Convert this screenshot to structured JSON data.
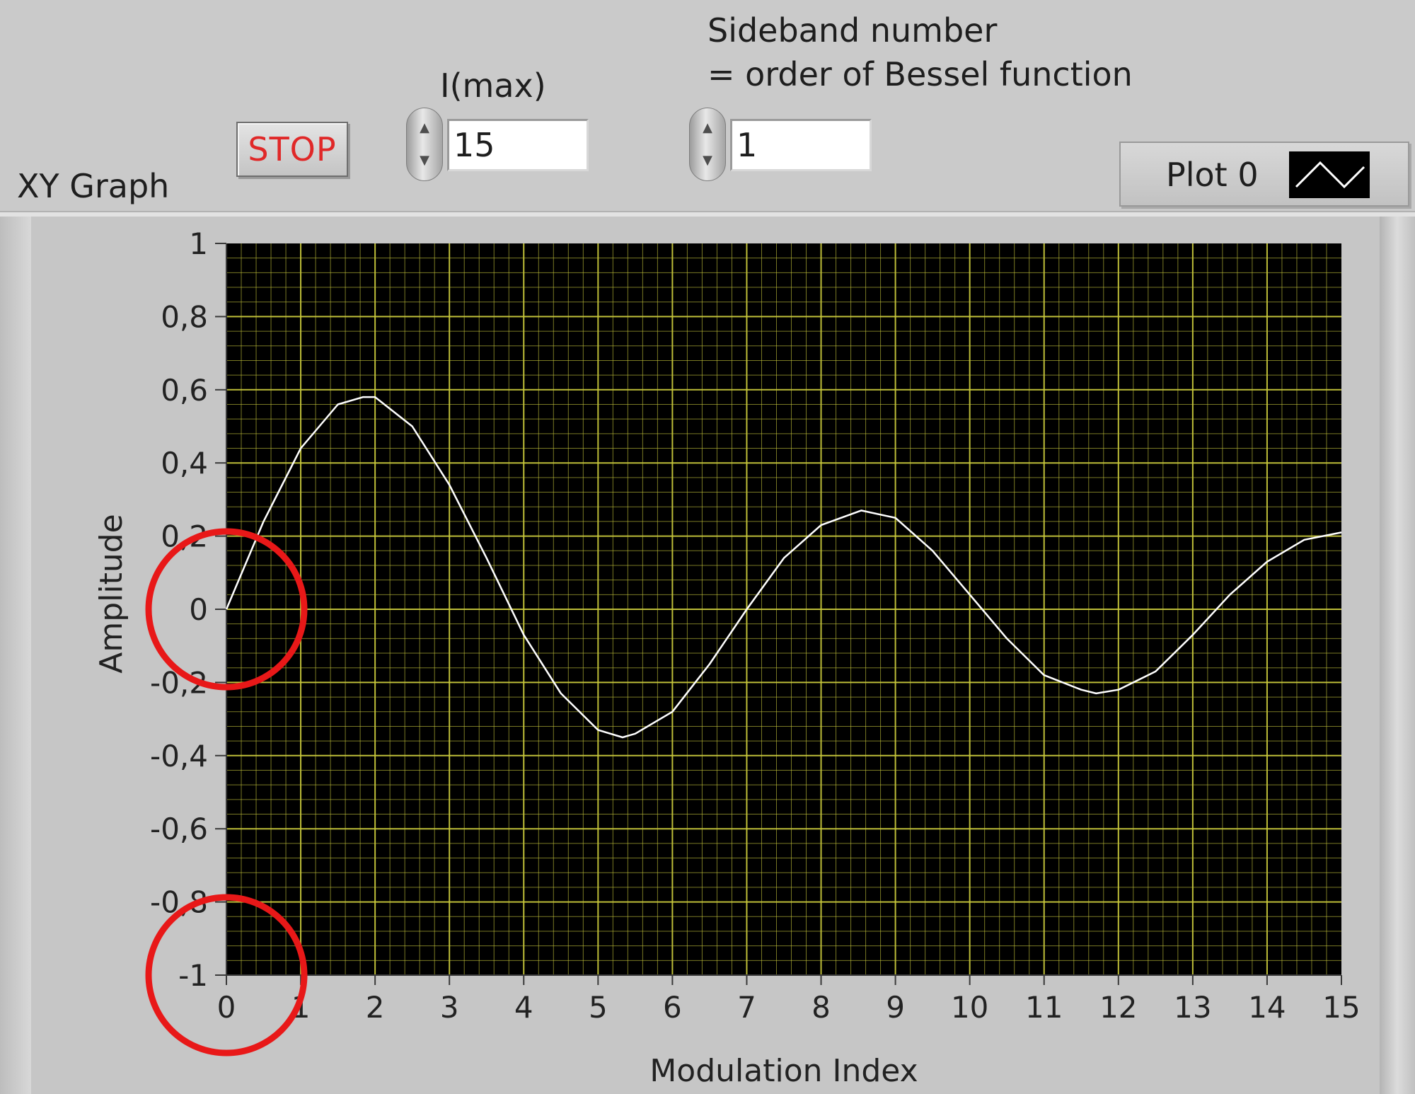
{
  "controls": {
    "stop_label": "STOP",
    "imax_label": "I(max)",
    "imax_value": "15",
    "sideband_label_line1": "Sideband number",
    "sideband_label_line2": "= order of Bessel function",
    "sideband_value": "1"
  },
  "graph": {
    "title": "XY Graph",
    "legend_label": "Plot 0"
  },
  "colors": {
    "plot_background": "#000000",
    "grid": "#c8c83c",
    "trace": "#ffffff",
    "highlight_circles": "#e81818",
    "stop_text": "#e02828"
  },
  "chart_data": {
    "type": "line",
    "xlabel": "Modulation Index",
    "ylabel": "Amplitude",
    "xlim": [
      0,
      15
    ],
    "ylim": [
      -1,
      1
    ],
    "x_ticks": [
      "0",
      "1",
      "2",
      "3",
      "4",
      "5",
      "6",
      "7",
      "8",
      "9",
      "10",
      "11",
      "12",
      "13",
      "14",
      "15"
    ],
    "y_ticks": [
      "1",
      "0,8",
      "0,6",
      "0,4",
      "0,2",
      "0",
      "-0,2",
      "-0,4",
      "-0,6",
      "-0,8",
      "-1"
    ],
    "grid": true,
    "series": [
      {
        "name": "Plot 0",
        "x": [
          0,
          0.5,
          1,
          1.5,
          1.84,
          2,
          2.5,
          3,
          3.5,
          4,
          4.5,
          5,
          5.33,
          5.5,
          6,
          6.5,
          7,
          7.5,
          8,
          8.54,
          9,
          9.5,
          10,
          10.5,
          11,
          11.5,
          11.7,
          12,
          12.5,
          13,
          13.5,
          14,
          14.5,
          15
        ],
        "y": [
          0,
          0.24,
          0.44,
          0.56,
          0.58,
          0.58,
          0.5,
          0.34,
          0.14,
          -0.07,
          -0.23,
          -0.33,
          -0.35,
          -0.34,
          -0.28,
          -0.15,
          0.0,
          0.14,
          0.23,
          0.27,
          0.25,
          0.16,
          0.04,
          -0.08,
          -0.18,
          -0.22,
          -0.23,
          -0.22,
          -0.17,
          -0.07,
          0.04,
          0.13,
          0.19,
          0.21
        ]
      }
    ],
    "annotations": [
      {
        "shape": "circle",
        "x": 0,
        "y": 0
      },
      {
        "shape": "circle",
        "x": 0,
        "y": -1
      }
    ]
  }
}
